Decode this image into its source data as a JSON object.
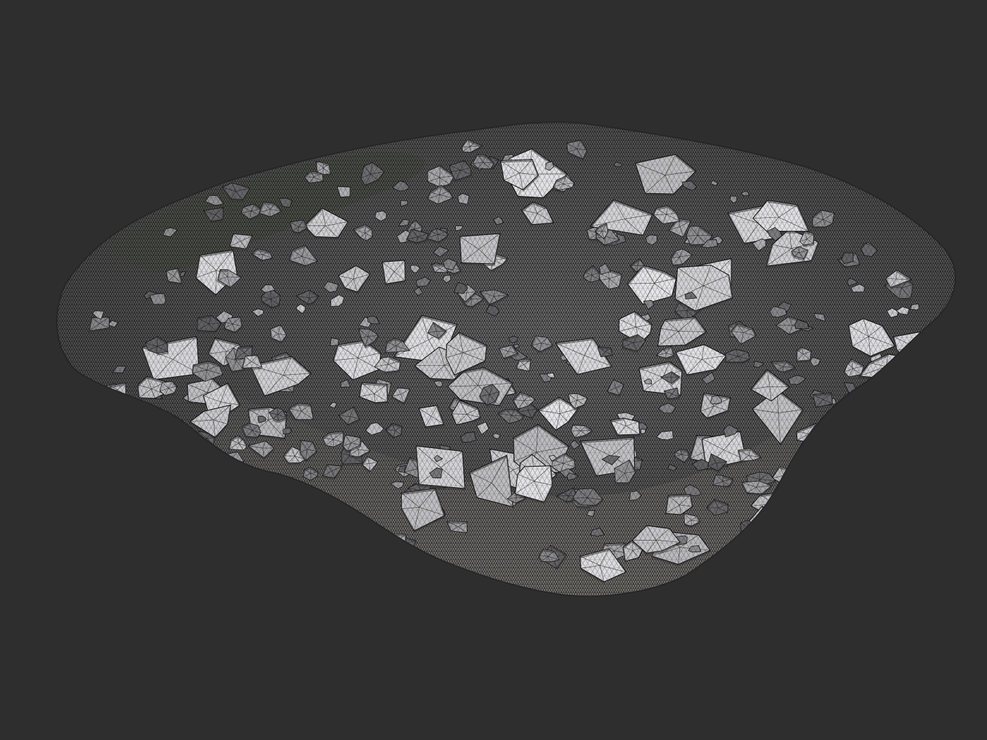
{
  "viewport": {
    "background_color": "#2e2e2e",
    "display_mode": "wireframe-on-shaded",
    "model": {
      "subject": "rubble pile",
      "surface_color": "#cfcfcf",
      "shadow_color": "#3a3a3a",
      "wire_color": "#111111",
      "moss_tint": "#7f8a6e"
    }
  }
}
